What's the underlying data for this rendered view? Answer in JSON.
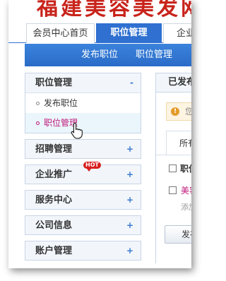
{
  "logo": {
    "text": "福建美容美发网"
  },
  "tabs": [
    {
      "label": "会员中心首页",
      "active": false
    },
    {
      "label": "职位管理",
      "active": true
    },
    {
      "label": "企业",
      "active": false
    }
  ],
  "subnav": {
    "publish": "发布职位",
    "manage": "职位管理"
  },
  "sidebar": {
    "job_group": {
      "label": "职位管理",
      "toggle": "-",
      "items": [
        {
          "label": "发布职位",
          "active": false
        },
        {
          "label": "职位管理",
          "active": true
        }
      ]
    },
    "groups": [
      {
        "label": "招聘管理",
        "toggle": "+"
      },
      {
        "label": "企业推广",
        "toggle": "+",
        "badge": "HOT"
      },
      {
        "label": "服务中心",
        "toggle": "+"
      },
      {
        "label": "公司信息",
        "toggle": "+"
      },
      {
        "label": "账户管理",
        "toggle": "+"
      }
    ]
  },
  "panel": {
    "title": "已发布",
    "notice": "您可",
    "filter_tab": "所有职",
    "column_header": "职位名",
    "job_title": "美容",
    "job_meta": "添加",
    "publish_button": "发布职"
  },
  "colors": {
    "accent": "#2f70d1",
    "active_link": "#c0187a",
    "logo": "#c8241b",
    "badge": "#d81e1e"
  }
}
